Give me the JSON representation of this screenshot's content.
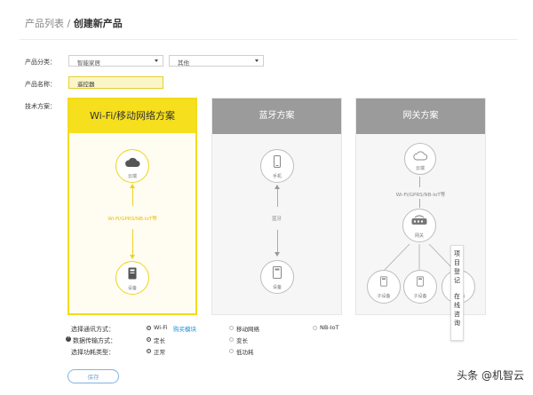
{
  "breadcrumb": {
    "parent": "产品列表",
    "separator": " / ",
    "current": "创建新产品"
  },
  "form": {
    "category_label": "产品分类：",
    "category_value": "智能家居",
    "subcategory_value": "其他",
    "name_label": "产品名称：",
    "name_value": "遥控器",
    "tech_label": "技术方案："
  },
  "cards": [
    {
      "title": "Wi-Fi/移动网络方案",
      "top_label": "云端",
      "link_label": "Wi-Fi/GPRS/NB-IoT等",
      "bottom_label": "设备",
      "selected": true
    },
    {
      "title": "蓝牙方案",
      "top_label": "手机",
      "link_label": "蓝牙",
      "bottom_label": "设备",
      "selected": false
    },
    {
      "title": "网关方案",
      "top_label": "云端",
      "link_label": "Wi-Fi/GPRS/NB-IoT等",
      "middle_label": "网关",
      "sub_labels": [
        "子设备",
        "子设备",
        "子设备"
      ],
      "selected": false
    }
  ],
  "options": {
    "comm": {
      "label": "选择通讯方式：",
      "choices": [
        "Wi-Fi",
        "移动网络",
        "NB-IoT"
      ],
      "buy_link": "购买模块",
      "selected": 0
    },
    "rate": {
      "label": "数据传输方式：",
      "choices": [
        "定长",
        "变长"
      ],
      "selected": 0
    },
    "power": {
      "label": "选择功耗类型：",
      "choices": [
        "正常",
        "低功耗"
      ],
      "selected": 0
    }
  },
  "save_label": "保存",
  "tooltip": {
    "line1": "项目登记",
    "line2": "在线咨询"
  },
  "watermark": "头条 @机智云",
  "colors": {
    "accent": "#f6df1c",
    "gray_header": "#9b9b9b",
    "link": "#1a8fd6"
  }
}
